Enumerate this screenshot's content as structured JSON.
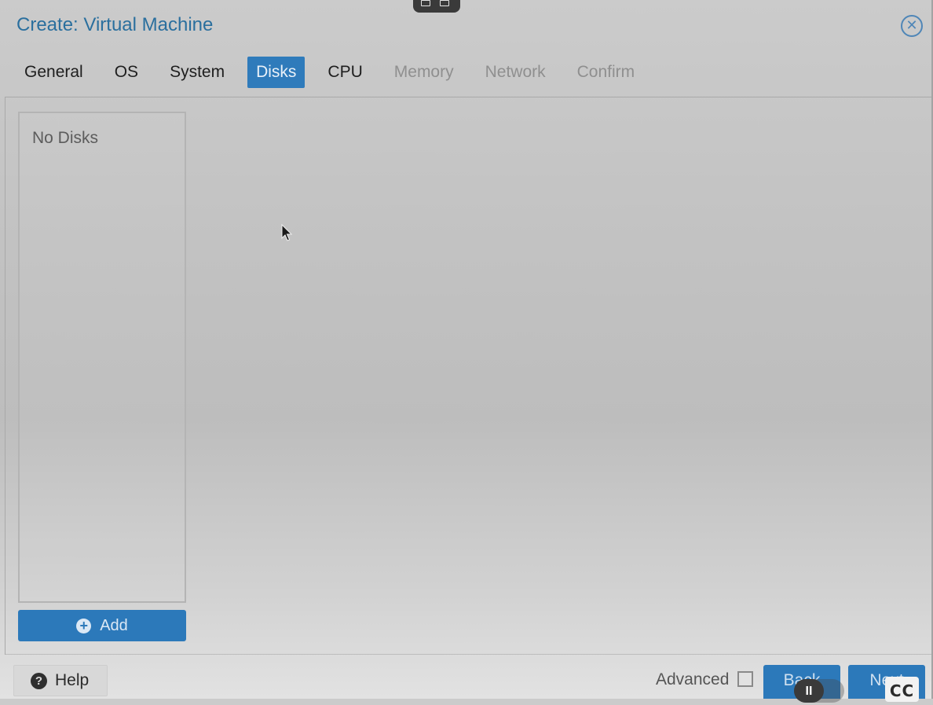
{
  "window": {
    "title": "Create: Virtual Machine",
    "close_icon": "close-circle-icon"
  },
  "tabs": [
    {
      "label": "General",
      "state": "normal"
    },
    {
      "label": "OS",
      "state": "normal"
    },
    {
      "label": "System",
      "state": "normal"
    },
    {
      "label": "Disks",
      "state": "active"
    },
    {
      "label": "CPU",
      "state": "normal"
    },
    {
      "label": "Memory",
      "state": "disabled"
    },
    {
      "label": "Network",
      "state": "disabled"
    },
    {
      "label": "Confirm",
      "state": "disabled"
    }
  ],
  "disk_list": {
    "empty_text": "No Disks"
  },
  "add_button": {
    "label": "Add",
    "icon": "plus-circle-icon"
  },
  "footer": {
    "help_label": "Help",
    "help_icon": "question-circle-icon",
    "advanced_label": "Advanced",
    "advanced_checked": false,
    "back_label": "Back",
    "next_label": "Next"
  },
  "video_overlay": {
    "cc_label": "CC"
  },
  "colors": {
    "accent": "#2c79ba",
    "title": "#2a6f9e",
    "disabled_tab": "#8f8f8f"
  }
}
